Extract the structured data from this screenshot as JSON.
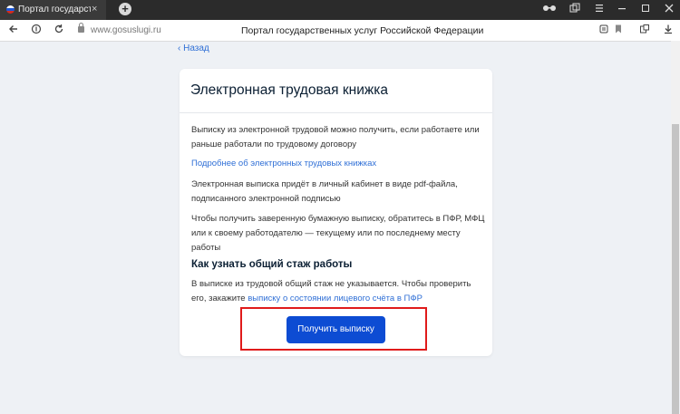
{
  "browser": {
    "tab": {
      "title": "Портал государственных",
      "close_glyph": "×"
    },
    "new_tab_glyph": "+",
    "url": "www.gosuslugi.ru",
    "page_title": "Портал государственных услуг Российской Федерации",
    "icons": {
      "back": "arrow-left-icon",
      "home": "yandex-home-icon",
      "reload": "reload-icon",
      "lock": "lock-icon",
      "reader": "reader-mode-icon",
      "bookmark": "bookmark-icon",
      "extensions": "extensions-icon",
      "download": "download-icon",
      "glasses": "glasses-icon",
      "tab-manager": "tab-manager-icon",
      "menu": "menu-icon",
      "minimize": "minimize-icon",
      "maximize": "maximize-icon",
      "close": "close-icon"
    }
  },
  "page": {
    "back_link": "Назад",
    "card": {
      "title": "Электронная трудовая книжка",
      "p1": "Выписку из электронной трудовой можно получить, если работаете или раньше работали по трудовому договору",
      "more_link": "Подробнее об электронных трудовых книжках",
      "p2": "Электронная выписка придёт в личный кабинет в виде pdf-файла, подписанного электронной подписью",
      "p3": "Чтобы получить заверенную бумажную выписку, обратитесь в ПФР, МФЦ или к своему работодателю — текущему или по последнему месту работы",
      "subheading": "Как узнать общий стаж работы",
      "p4_text": "В выписке из трудовой общий стаж не указывается. Чтобы проверить его, закажите ",
      "p4_link": "выписку о состоянии лицевого счёта в ПФР",
      "cta_label": "Получить выписку"
    }
  },
  "colors": {
    "accent": "#0d4cd3",
    "link": "#2f6fd6",
    "highlight": "#e01b1b",
    "tabbar": "#2b2b2b"
  }
}
